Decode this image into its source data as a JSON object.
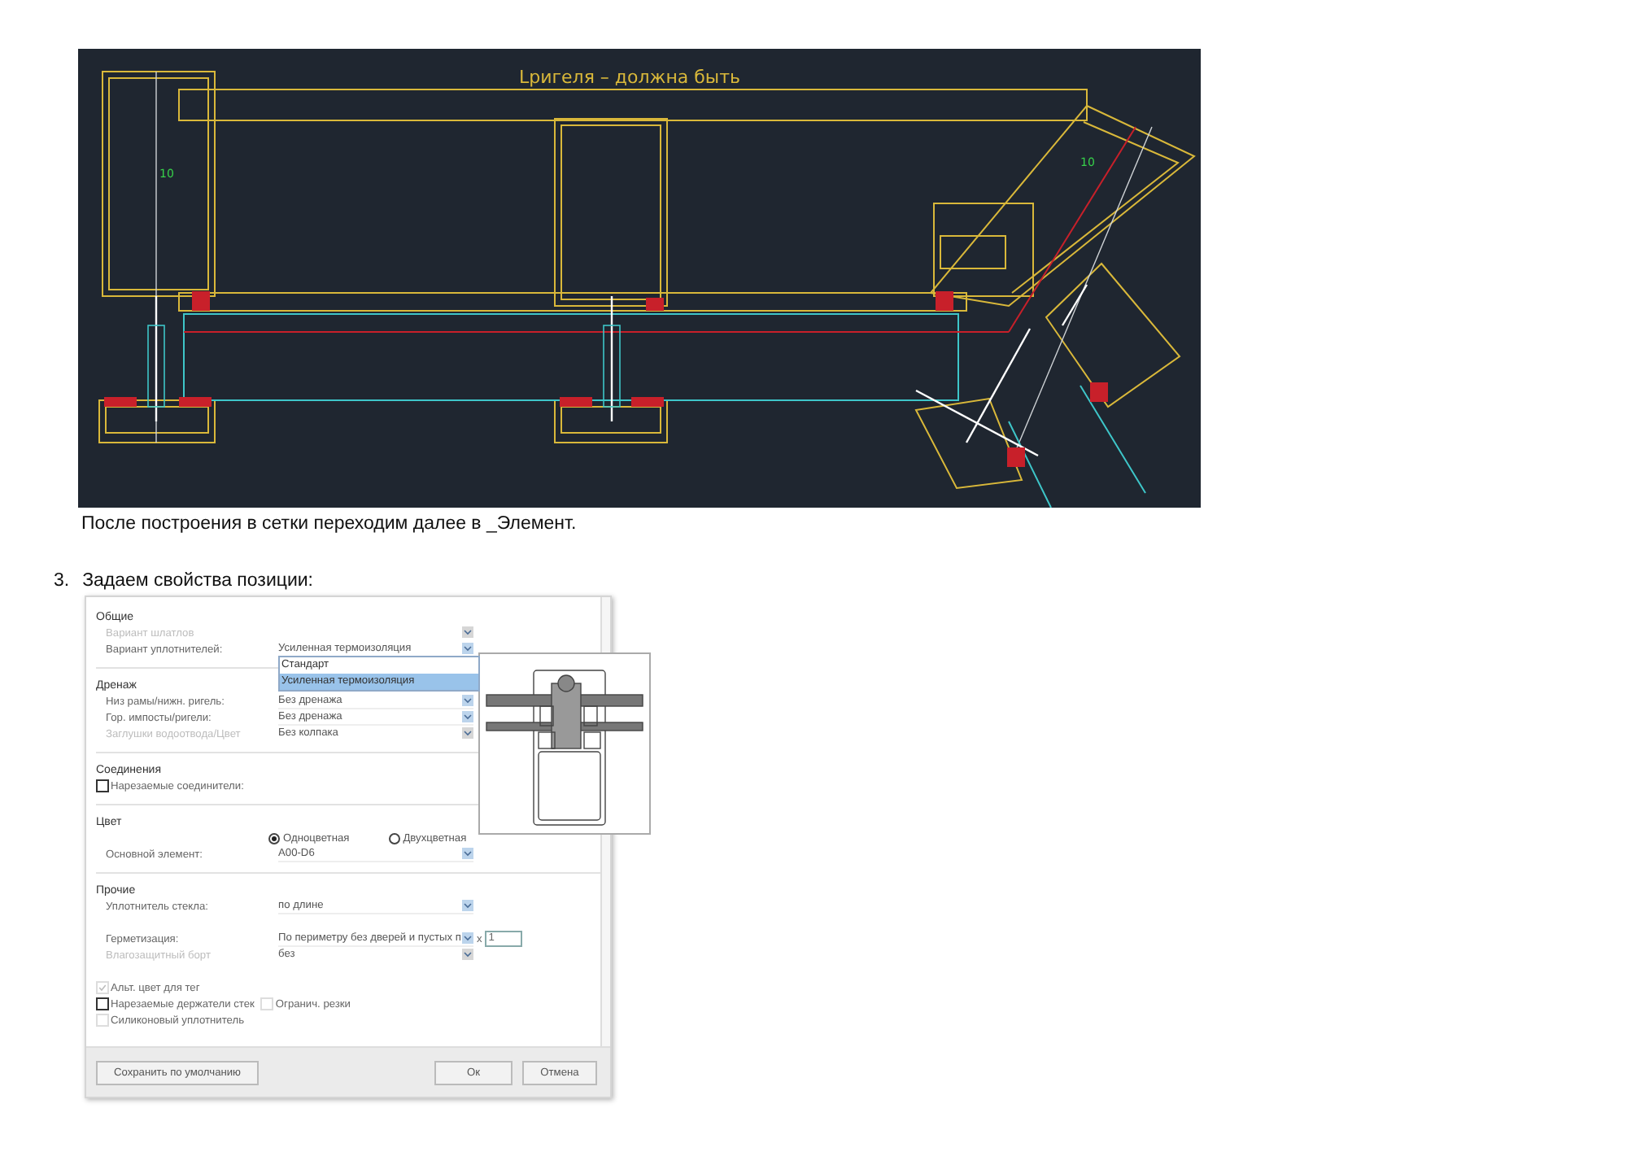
{
  "cad": {
    "title": "Lригеля – должна быть",
    "dims": [
      "10",
      "10"
    ]
  },
  "caption": "После построения в сетки переходим далее в _Элемент.",
  "step": {
    "number": "3.",
    "text": "Задаем свойства позиции:"
  },
  "dialog": {
    "sections": [
      {
        "title": "Общие",
        "rows": [
          {
            "kind": "select",
            "label": "Вариант шлатлов",
            "disabled": true
          },
          {
            "kind": "select",
            "label": "Вариант уплотнителей:",
            "value": "Усиленная термоизоляция",
            "disabled": false,
            "options": [
              {
                "label": "Стандарт",
                "selected": false
              },
              {
                "label": "Усиленная термоизоляция",
                "selected": true
              }
            ]
          }
        ]
      },
      {
        "title": "Дренаж",
        "rows": [
          {
            "kind": "select",
            "label": "Низ рамы/нижн. ригель:",
            "value": "Без дренажа",
            "disabled": false
          },
          {
            "kind": "select",
            "label": "Гор. импосты/ригели:",
            "value": "Без дренажа",
            "disabled": false
          },
          {
            "kind": "select",
            "label": "Заглушки водоотвода/Цвет",
            "value": "Без колпака",
            "disabled": true
          }
        ]
      },
      {
        "title": "Соединения",
        "rows": [
          {
            "kind": "checkbox",
            "label": "Нарезаемые соединители:",
            "checked": false,
            "disabled": false
          }
        ]
      },
      {
        "title": "Цвет",
        "rows": [
          {
            "kind": "radios",
            "options": [
              {
                "label": "Одноцветная",
                "selected": true
              },
              {
                "label": "Двухцветная",
                "selected": false
              }
            ]
          },
          {
            "kind": "select",
            "label": "Основной элемент:",
            "value": "A00-D6",
            "disabled": false
          }
        ]
      },
      {
        "title": "Прочие",
        "rows": [
          {
            "kind": "select",
            "label": "Уплотнитель стекла:",
            "value": "по длине",
            "disabled": false
          },
          {
            "kind": "gap"
          },
          {
            "kind": "select",
            "label": "Герметизация:",
            "value": "По периметру без дверей и пустых п",
            "disabled": false,
            "multiplier": {
              "sign": "x",
              "value": "1"
            }
          },
          {
            "kind": "select",
            "label": "Влагозащитный борт",
            "value": "без",
            "disabled": true
          },
          {
            "kind": "gap"
          },
          {
            "kind": "checkbox",
            "label": "Альт. цвет для тег",
            "checked": true,
            "disabled": true
          },
          {
            "kind": "checkboxes",
            "items": [
              {
                "label": "Нарезаемые держатели стек",
                "checked": false,
                "disabled": false
              },
              {
                "label": "Огранич. резки",
                "checked": false,
                "disabled": true
              }
            ]
          },
          {
            "kind": "checkbox",
            "label": "Силиконовый уплотнитель",
            "checked": false,
            "disabled": true
          }
        ]
      }
    ],
    "buttons": [
      {
        "label": "Сохранить по умолчанию",
        "kind": "secondary"
      },
      {
        "label": "Ок",
        "kind": "ok"
      },
      {
        "label": "Отмена",
        "kind": "cancel"
      }
    ]
  }
}
